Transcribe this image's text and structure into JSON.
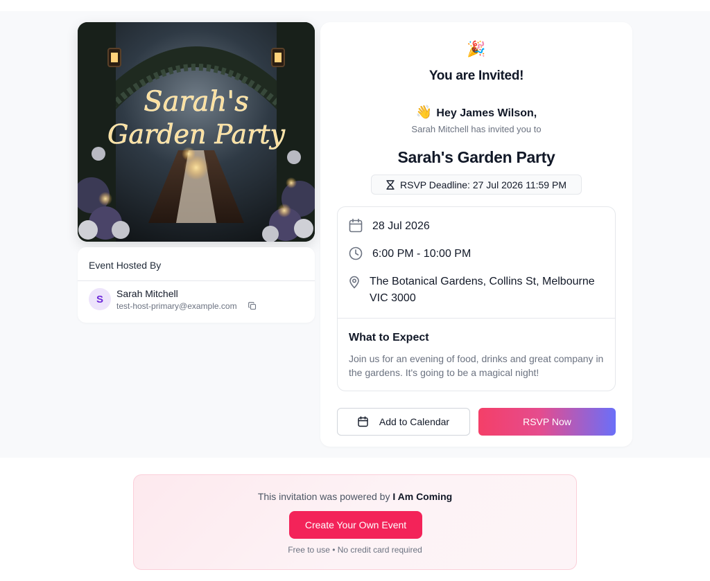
{
  "hero": {
    "image_title_line1": "Sarah's",
    "image_title_line2": "Garden Party"
  },
  "host": {
    "section_title": "Event Hosted By",
    "avatar_initial": "S",
    "name": "Sarah Mitchell",
    "email": "test-host-primary@example.com"
  },
  "invite": {
    "party_emoji": "🎉",
    "heading": "You are Invited!",
    "wave_emoji": "👋",
    "greeting": "Hey James Wilson,",
    "invited_by": "Sarah Mitchell has invited you to",
    "event_title": "Sarah's Garden Party",
    "rsvp_deadline": "RSVP Deadline: 27 Jul 2026 11:59 PM"
  },
  "details": {
    "date": "28 Jul 2026",
    "time": "6:00 PM - 10:00 PM",
    "location_line1": "The Botanical Gardens, Collins St, Melbourne",
    "location_line2": "VIC 3000",
    "expect_title": "What to Expect",
    "expect_text": "Join us for an evening of food, drinks and great company in the gardens. It's going to be a magical night!"
  },
  "actions": {
    "add_to_calendar": "Add to Calendar",
    "rsvp_now": "RSVP Now"
  },
  "promo": {
    "powered_prefix": "This invitation was powered by",
    "brand": "I Am Coming",
    "create_button": "Create Your Own Event",
    "subtext": "Free to use • No credit card required"
  },
  "icons": {
    "party": "party-popper-icon",
    "wave": "waving-hand-icon",
    "hourglass": "hourglass-icon",
    "calendar": "calendar-icon",
    "clock": "clock-icon",
    "location": "map-pin-icon",
    "copy": "copy-icon"
  },
  "colors": {
    "rsvp_gradient_start": "#f43f68",
    "rsvp_gradient_end": "#6a6ff8",
    "create_button": "#f32359",
    "avatar_bg": "#ede4fb",
    "avatar_text": "#6d28d9",
    "page_bg": "#f8f9fb"
  }
}
